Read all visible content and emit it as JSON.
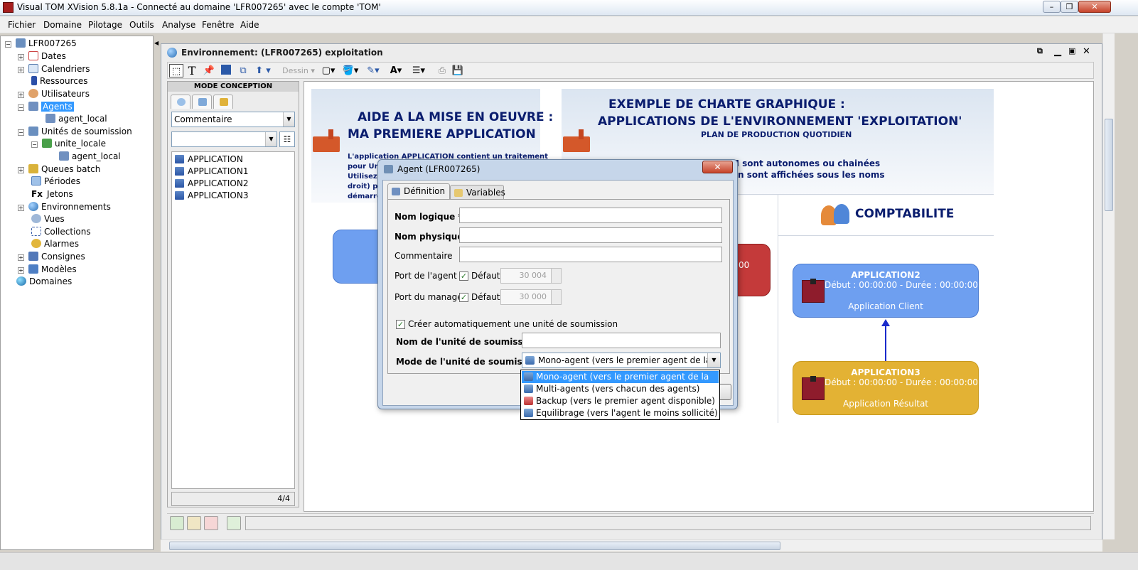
{
  "window": {
    "title": "Visual TOM XVision 5.8.1a - Connecté au domaine 'LFR007265' avec le compte 'TOM'"
  },
  "menu": [
    "Fichier",
    "Domaine",
    "Pilotage",
    "Outils",
    "Analyse",
    "Fenêtre",
    "Aide"
  ],
  "tree": {
    "root": "LFR007265",
    "items": [
      {
        "label": "Dates"
      },
      {
        "label": "Calendriers"
      },
      {
        "label": "Ressources"
      },
      {
        "label": "Utilisateurs"
      },
      {
        "label": "Agents",
        "selected": true
      },
      {
        "label": "agent_local"
      },
      {
        "label": "Unités de soumission"
      },
      {
        "label": "unite_locale"
      },
      {
        "label": "agent_local"
      },
      {
        "label": "Queues batch"
      },
      {
        "label": "Périodes"
      },
      {
        "label": "Jetons",
        "prefix": "Fx"
      },
      {
        "label": "Environnements"
      },
      {
        "label": "Vues"
      },
      {
        "label": "Collections"
      },
      {
        "label": "Alarmes"
      },
      {
        "label": "Consignes"
      },
      {
        "label": "Modèles"
      },
      {
        "label": "Domaines"
      }
    ]
  },
  "inner_window": {
    "title": "Environnement: (LFR007265) exploitation",
    "toolbar": {
      "dessin_label": "Dessin"
    }
  },
  "palette": {
    "header": "MODE CONCEPTION",
    "comment_select": "Commentaire",
    "filter_value": "",
    "items": [
      "APPLICATION",
      "APPLICATION1",
      "APPLICATION2",
      "APPLICATION3"
    ],
    "count": "4/4"
  },
  "canvas": {
    "left_panel": {
      "title_line1": "AIDE A LA MISE EN OEUVRE :",
      "title_line2": "MA PREMIERE APPLICATION",
      "text_lines": [
        "L'application APPLICATION contient un traitement",
        "pour Uni",
        "Utilisez l",
        "droit) pou",
        "démarrer"
      ]
    },
    "right_panel": {
      "title_line1": "EXEMPLE DE CHARTE GRAPHIQUE :",
      "title_line2": "APPLICATIONS DE L'ENVIRONNEMENT 'EXPLOITATION'",
      "subtitle": "PLAN DE PRODUCTION QUOTIDIEN",
      "bullet1": "M sont autonomes ou chainées",
      "bullet2": "n sont affichées sous les noms"
    },
    "comptabilite": "COMPTABILITE",
    "red_box_fragment": "00",
    "apps": [
      {
        "name": "APPLICATION2",
        "timing": "Début : 00:00:00 - Durée : 00:00:00",
        "subtitle": "Application Client",
        "color": "#6e9ff0"
      },
      {
        "name": "APPLICATION3",
        "timing": "Début : 00:00:00 - Durée : 00:00:00",
        "subtitle": "Application Résultat",
        "color": "#e3b234"
      }
    ]
  },
  "dialog": {
    "title": "Agent (LFR007265)",
    "tabs": [
      "Définition",
      "Variables"
    ],
    "labels": {
      "nom_logique": "Nom logique *",
      "nom_physique": "Nom physique *",
      "commentaire": "Commentaire",
      "port_agent": "Port de l'agent",
      "port_manager": "Port du manager",
      "defaut": "Défaut",
      "creer_auto": "Créer automatiquement une unité de soumission",
      "nom_unite": "Nom de l'unité de soumission *",
      "mode_unite": "Mode de l'unité de soumission *"
    },
    "values": {
      "nom_logique": "",
      "nom_physique": "",
      "commentaire": "",
      "port_agent": "30 004",
      "port_manager": "30 000",
      "nom_unite": "",
      "mode_unite": "Mono-agent (vers le premier agent de la liste)"
    },
    "checkboxes": {
      "port_agent_defaut": true,
      "port_manager_defaut": true,
      "creer_auto": true
    },
    "mode_options": [
      "Mono-agent (vers le premier agent de la liste)",
      "Multi-agents (vers chacun des agents)",
      "Backup (vers le premier agent disponible)",
      "Equilibrage (vers l'agent le moins sollicité)"
    ],
    "close_label": "✕"
  },
  "colors": {
    "accent": "#3399ff",
    "title_navy": "#0a1d6e"
  }
}
